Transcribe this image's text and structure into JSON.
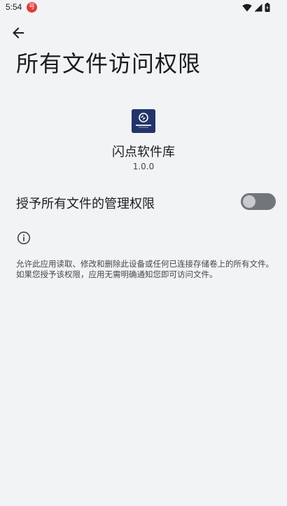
{
  "status_bar": {
    "time": "5:54",
    "app_badge": "号",
    "icons": [
      "wifi-icon",
      "signal-icon",
      "battery-icon"
    ]
  },
  "header": {
    "back_icon": "arrow-back-icon",
    "title": "所有文件访问权限"
  },
  "app_info": {
    "icon": "flash-app-icon",
    "name": "闪点软件库",
    "version": "1.0.0"
  },
  "permission": {
    "label": "授予所有文件的管理权限",
    "enabled": false
  },
  "info": {
    "icon": "info-icon",
    "text": "允许此应用读取、修改和删除此设备或任何已连接存储卷上的所有文件。如果您授予该权限，应用无需明确通知您即可访问文件。"
  },
  "colors": {
    "background": "#f2f3f5",
    "text_primary": "#1b1c1e",
    "text_secondary": "#45474a",
    "toggle_track_off": "#727579",
    "toggle_thumb_off": "#c8cacd",
    "app_icon_bg": "#22346a",
    "status_badge": "#e53935"
  }
}
